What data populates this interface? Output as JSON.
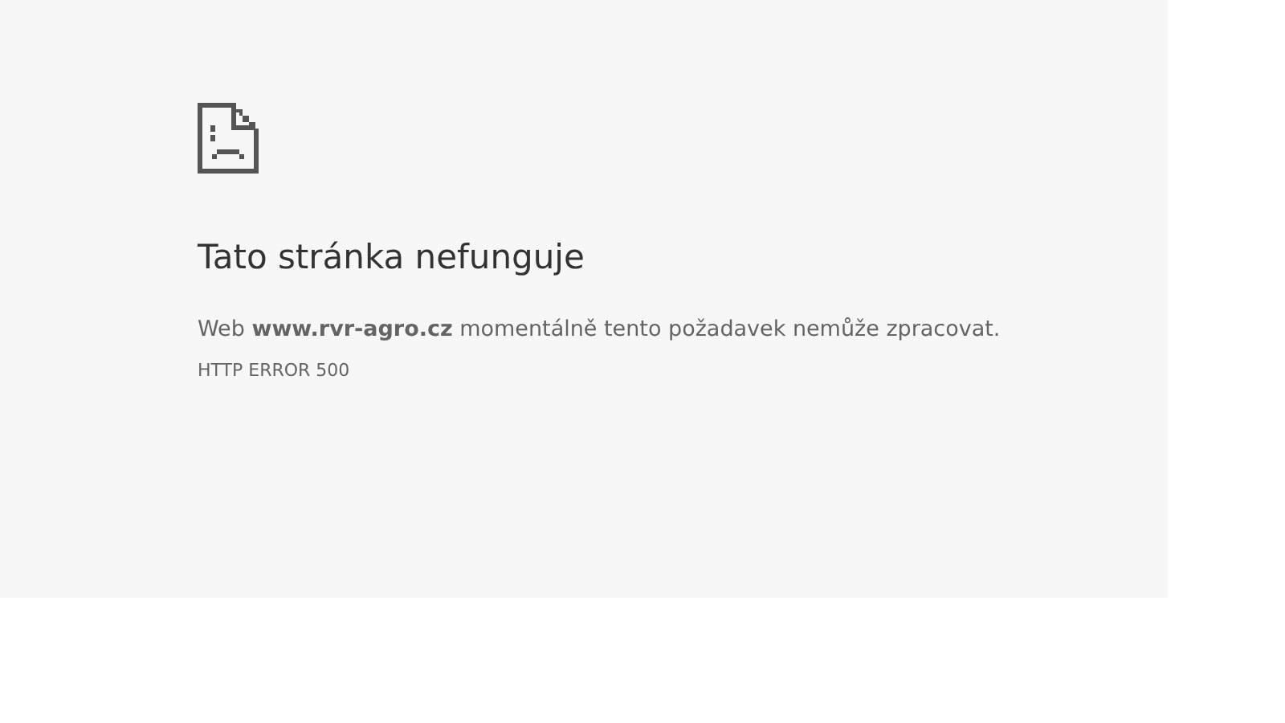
{
  "heading": "Tato stránka nefunguje",
  "message": "Web **www.rvr-agro.cz** momentálně tento požadavek nemůže zpracovat.",
  "error_code": "HTTP ERROR 500"
}
